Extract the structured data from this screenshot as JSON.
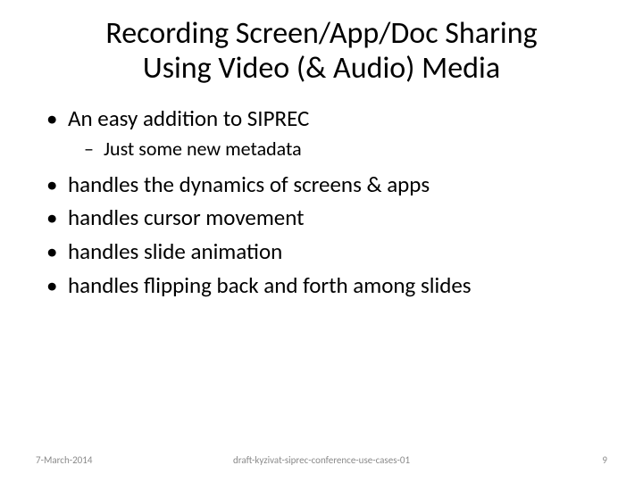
{
  "title_line1": "Recording Screen/App/Doc Sharing",
  "title_line2": "Using Video (& Audio) Media",
  "bullets": {
    "b1": "An easy addition to SIPREC",
    "b1_sub1": "Just some new metadata",
    "b2": "handles the dynamics of screens & apps",
    "b3": "handles cursor movement",
    "b4": "handles slide animation",
    "b5": "handles flipping back and forth among slides"
  },
  "footer": {
    "date": "7-March-2014",
    "doc": "draft-kyzivat-siprec-conference-use-cases-01",
    "page": "9"
  }
}
